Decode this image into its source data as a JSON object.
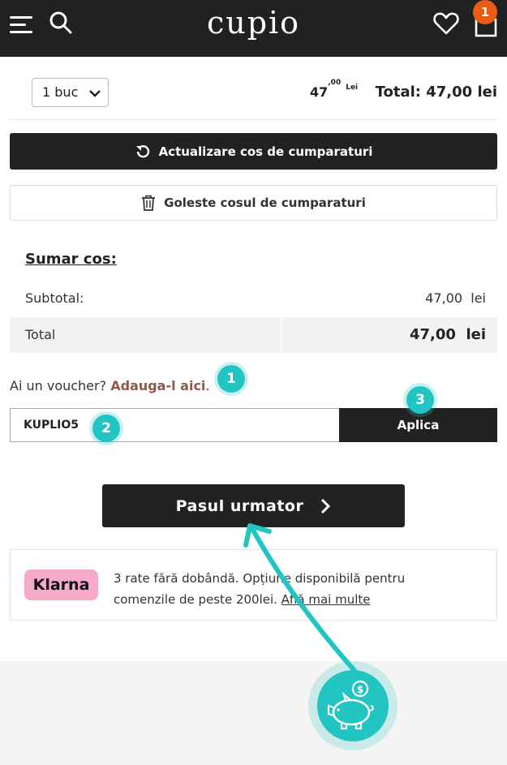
{
  "header": {
    "logo": "cupio",
    "cart_count": "1"
  },
  "cart_row": {
    "quantity": "1 buc",
    "price_int": "47",
    "price_dec": ",00",
    "price_currency": "Lei",
    "total": "Total: 47,00 lei"
  },
  "buttons": {
    "update_cart": "Actualizare cos de cumparaturi",
    "empty_cart": "Goleste cosul de cumparaturi",
    "apply": "Aplica",
    "next_step": "Pasul urmator"
  },
  "summary": {
    "title": "Sumar cos:",
    "subtotal_label": "Subtotal:",
    "subtotal_value": "47,00  lei",
    "total_label": "Total",
    "total_value": "47,00  lei"
  },
  "voucher": {
    "question": "Ai un voucher? ",
    "link": "Adauga-l aici",
    "link_suffix": ".",
    "code": "KUPLIO5"
  },
  "markers": [
    "1",
    "2",
    "3"
  ],
  "klarna": {
    "logo": "Klarna",
    "text": "3 rate fără dobândă. Opțiune disponibilă pentru comenzile de peste 200lei. ",
    "link": "Află mai multe"
  },
  "colors": {
    "header_bg": "#212121",
    "accent_teal": "#22c5c2",
    "badge_orange": "#ea5b13",
    "voucher_link": "#8c5a4b",
    "klarna_pink": "#f4aac8"
  }
}
